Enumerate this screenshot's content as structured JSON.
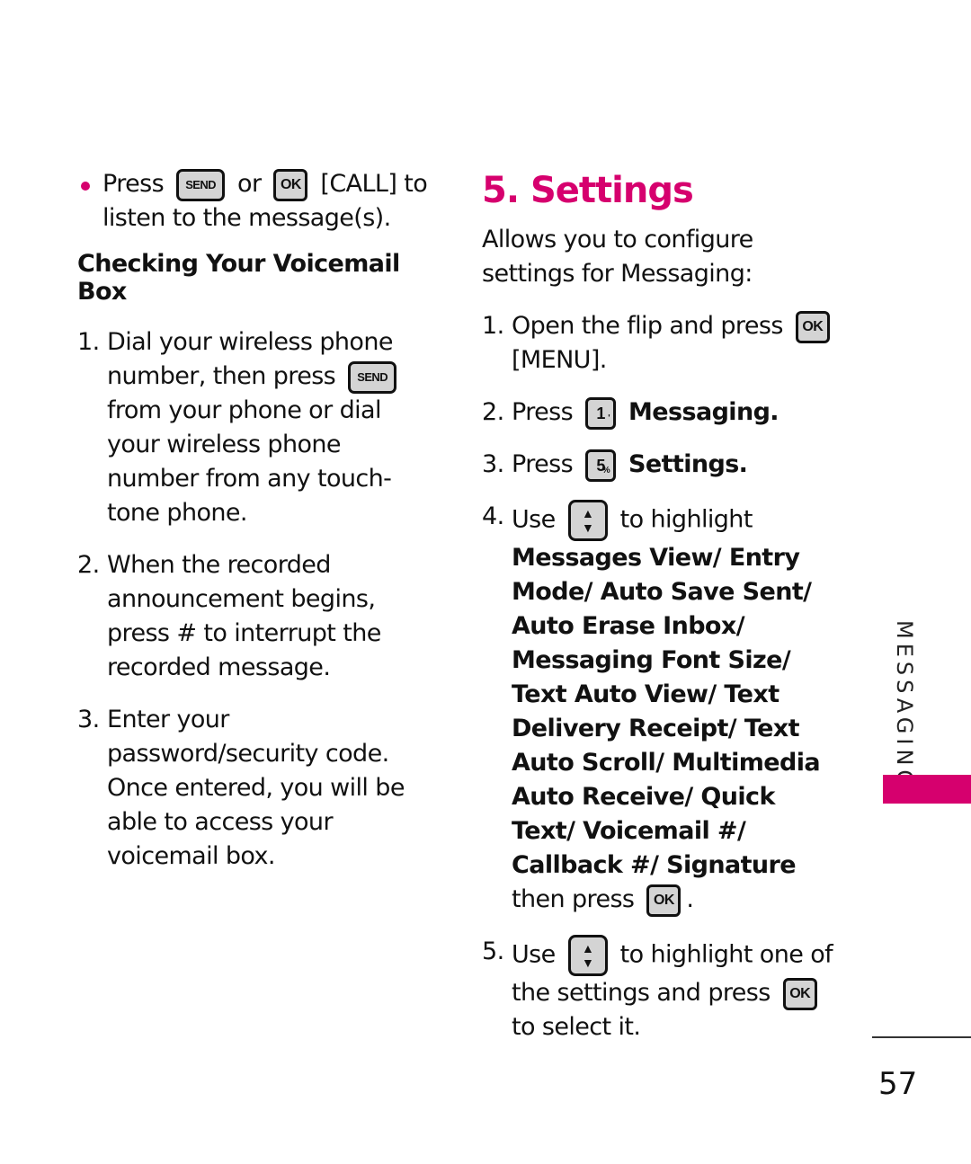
{
  "left_column": {
    "bullet": {
      "pre": "Press",
      "key1": "SEND",
      "mid": "or",
      "key2": "OK",
      "post": "[CALL] to listen to the message(s).",
      "bullet_color": "#d6006e"
    },
    "heading": "Checking Your Voicemail Box",
    "steps": [
      {
        "num": "1.",
        "pre": "Dial your wireless phone number, then press",
        "key": "SEND",
        "post": "from your phone or dial your wireless phone number from any touch-tone phone."
      },
      {
        "num": "2.",
        "text": "When the recorded announcement begins, press # to interrupt the recorded message."
      },
      {
        "num": "3.",
        "text": "Enter your password/security code. Once entered, you will be able to access your voicemail box."
      }
    ]
  },
  "right_column": {
    "title": "5. Settings",
    "title_color": "#d6006e",
    "intro": "Allows you to configure settings for Messaging:",
    "steps": [
      {
        "num": "1.",
        "pre": "Open the flip and press",
        "key": "OK",
        "post": "[MENU]."
      },
      {
        "num": "2.",
        "pre": "Press",
        "key": "1",
        "key_sup": "'",
        "post_bold": "Messaging."
      },
      {
        "num": "3.",
        "pre": "Press",
        "key": "5",
        "key_sup": "%",
        "post_bold": "Settings."
      },
      {
        "num": "4.",
        "pre": "Use",
        "key_icon": "nav-up-down-key",
        "mid": "to highlight",
        "bold": "Messages View/ Entry Mode/ Auto Save Sent/ Auto Erase Inbox/ Messaging Font Size/ Text Auto View/ Text Delivery Receipt/ Text Auto Scroll/ Multimedia Auto Receive/ Quick Text/ Voicemail #/ Callback #/ Signature",
        "then": "then press",
        "key2": "OK",
        "end": "."
      },
      {
        "num": "5.",
        "pre": "Use",
        "key_icon": "nav-up-down-key",
        "mid": "to highlight one of the settings and press",
        "key2": "OK",
        "end": "to select it."
      }
    ]
  },
  "side_tab": {
    "label": "MESSAGING",
    "accent": "#d6006e"
  },
  "footer": {
    "page_number": "57"
  }
}
